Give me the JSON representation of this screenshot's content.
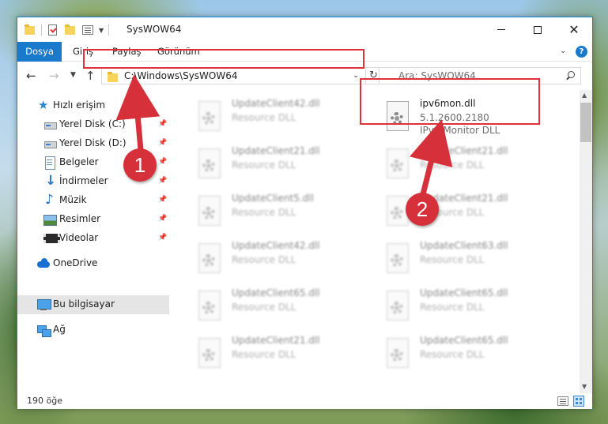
{
  "window": {
    "title": "SysWOW64",
    "controls": {
      "minimize": "—",
      "maximize": "□",
      "close": "✕"
    }
  },
  "ribbon": {
    "tabs": [
      "Dosya",
      "Giriş",
      "Paylaş",
      "Görünüm"
    ],
    "help": "?"
  },
  "nav": {
    "address": "C:\\Windows\\SysWOW64",
    "search_placeholder": "Ara: SysWOW64"
  },
  "sidebar": {
    "items": [
      {
        "label": "Hızlı erişim",
        "icon": "star-icon"
      },
      {
        "label": "Yerel Disk (C:)",
        "icon": "disk-icon",
        "pinned": true
      },
      {
        "label": "Yerel Disk (D:)",
        "icon": "disk-icon",
        "pinned": true
      },
      {
        "label": "Belgeler",
        "icon": "documents-icon",
        "pinned": true
      },
      {
        "label": "İndirmeler",
        "icon": "downloads-icon",
        "pinned": true
      },
      {
        "label": "Müzik",
        "icon": "music-icon",
        "pinned": true
      },
      {
        "label": "Resimler",
        "icon": "pictures-icon",
        "pinned": true
      },
      {
        "label": "Videolar",
        "icon": "videos-icon",
        "pinned": true
      },
      {
        "label": "OneDrive",
        "icon": "onedrive-icon"
      },
      {
        "label": "Bu bilgisayar",
        "icon": "this-pc-icon",
        "selected": true
      },
      {
        "label": "Ağ",
        "icon": "network-icon"
      }
    ]
  },
  "files": {
    "left_column": [
      {
        "name": "UpdateClient42.dll",
        "type": "Resource DLL"
      },
      {
        "name": "UpdateClient21.dll",
        "type": "Resource DLL"
      },
      {
        "name": "UpdateClient5.dll",
        "type": "Resource DLL"
      },
      {
        "name": "UpdateClient42.dll",
        "type": "Resource DLL"
      },
      {
        "name": "UpdateClient65.dll",
        "type": "Resource DLL"
      },
      {
        "name": "UpdateClient21.dll",
        "type": "Resource DLL"
      }
    ],
    "highlighted": {
      "name": "ipv6mon.dll",
      "version": "5.1.2600.2180",
      "description": "IPv6 Monitor DLL"
    },
    "right_column": [
      {
        "name": "UpdateClient21.dll",
        "type": "Resource DLL"
      },
      {
        "name": "UpdateClient21.dll",
        "type": "Resource DLL"
      },
      {
        "name": "UpdateClient63.dll",
        "type": "Resource DLL"
      },
      {
        "name": "UpdateClient65.dll",
        "type": "Resource DLL"
      },
      {
        "name": "UpdateClient65.dll",
        "type": "Resource DLL"
      }
    ]
  },
  "status": {
    "item_count": "190 öğe"
  },
  "annotations": {
    "step1": "1",
    "step2": "2",
    "color": "#d6313a"
  }
}
